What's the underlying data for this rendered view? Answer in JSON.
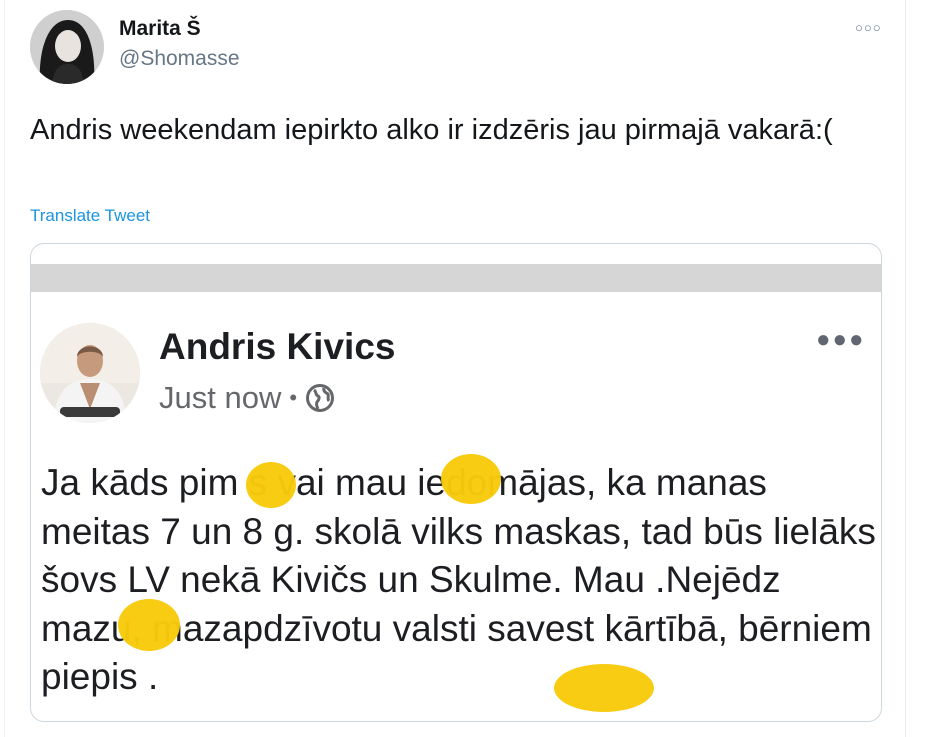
{
  "tweet": {
    "author_name": "Marita Š",
    "author_handle": "@Shomasse",
    "more_icon": "more-horizontal-icon",
    "text": "Andris weekendam iepirkto alko ir izdzēris jau pirmajā vakarā:(",
    "translate_label": "Translate Tweet"
  },
  "embedded_post": {
    "author_name": "Andris Kivics",
    "time": "Just now",
    "separator": "•",
    "audience_icon": "globe-icon",
    "more_icon": "more-horizontal-icon",
    "text": "Ja kāds pim    s vai mau      iedomājas, ka manas meitas 7 un 8 g. skolā vilks maskas, tad būs lielāks šovs LV nekā Kivičs un Skulme. Mau       .Nejēdz mazu, mazapdzīvotu valsti savest kārtībā, bērniem piepis          ."
  },
  "colors": {
    "link": "#1b95e0",
    "redaction": "#f8ca0a",
    "secondary_text": "#657786"
  }
}
